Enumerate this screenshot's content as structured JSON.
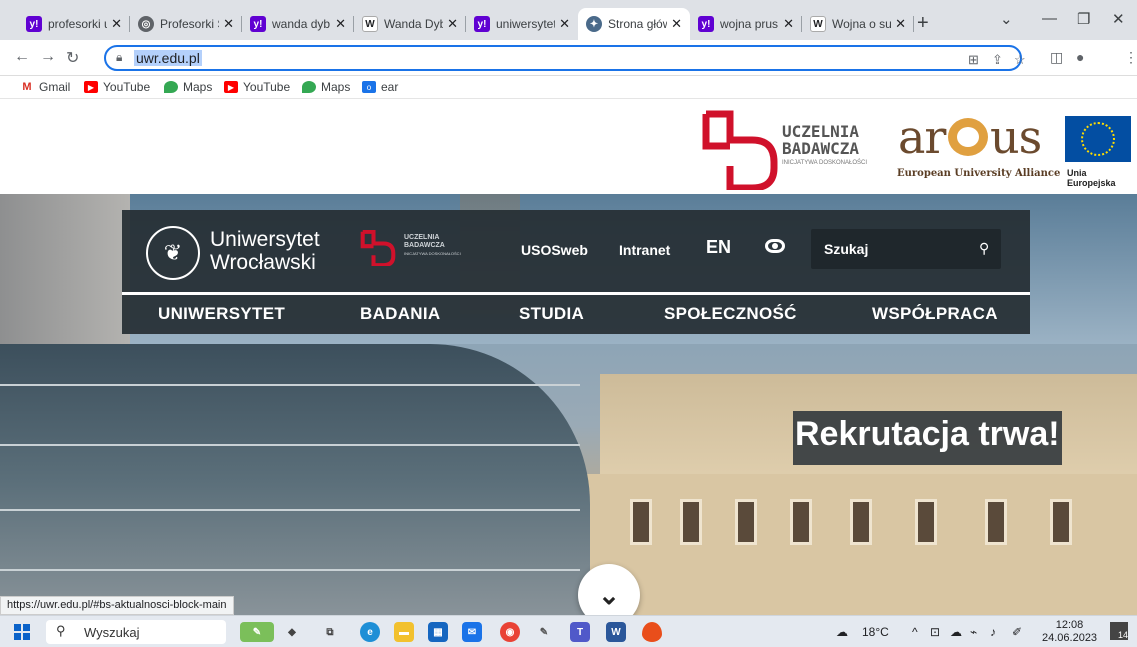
{
  "tabs": [
    {
      "title": "profesorki u",
      "favicon": "yahoo",
      "color": "#6001d2"
    },
    {
      "title": "Profesorki S",
      "favicon": "globe",
      "color": "#5f6368"
    },
    {
      "title": "wanda dyb",
      "favicon": "yahoo",
      "color": "#6001d2"
    },
    {
      "title": "Wanda Dyb",
      "favicon": "wikipedia",
      "color": "#202124"
    },
    {
      "title": "uniwersytet",
      "favicon": "yahoo",
      "color": "#6001d2"
    },
    {
      "title": "Strona głów",
      "favicon": "uwr-crest",
      "color": "#4a6a8a",
      "active": true
    },
    {
      "title": "wojna prus",
      "favicon": "yahoo",
      "color": "#6001d2"
    },
    {
      "title": "Wojna o su",
      "favicon": "wikipedia",
      "color": "#202124"
    }
  ],
  "address": {
    "url": "uwr.edu.pl"
  },
  "bookmarks": [
    {
      "label": "Gmail",
      "color": "#d93025",
      "icon": "M"
    },
    {
      "label": "YouTube",
      "color": "#ff0000",
      "icon": "▶"
    },
    {
      "label": "Maps",
      "color": "#34a853",
      "icon": "◉"
    },
    {
      "label": "YouTube",
      "color": "#ff0000",
      "icon": "▶"
    },
    {
      "label": "Maps",
      "color": "#34a853",
      "icon": "◉"
    },
    {
      "label": "ear",
      "color": "#1a73e8",
      "icon": "o"
    }
  ],
  "banner": {
    "ub_title_line1": "UCZELNIA",
    "ub_title_line2": "BADAWCZA",
    "ub_subtitle": "INICJATYWA DOSKONAŁOŚCI",
    "arqus_name": "arqus",
    "arqus_tagline": "European University Alliance",
    "eu_label": "Unia Europejska",
    "brand_red": "#d0112b",
    "arqus_brown": "#6b4a2e",
    "arqus_gold": "#e0a040",
    "eu_blue": "#034ea2"
  },
  "site": {
    "name_line1": "Uniwersytet",
    "name_line2": "Wrocławski",
    "ub_small_line1": "UCZELNIA",
    "ub_small_line2": "BADAWCZA",
    "ub_small_line3": "INICJATYWA DOSKONAŁOŚCI",
    "top_links": [
      "USOSweb",
      "Intranet"
    ],
    "lang": "EN",
    "search_placeholder": "Szukaj",
    "menu": [
      "UNIWERSYTET",
      "BADANIA",
      "STUDIA",
      "SPOŁECZNOŚĆ",
      "WSPÓŁPRACA"
    ],
    "hero_headline": "Rekrutacja trwa!"
  },
  "status_url": "https://uwr.edu.pl/#bs-aktualnosci-block-main",
  "taskbar": {
    "search_placeholder": "Wyszukaj",
    "weather": "18°C",
    "time": "12:08",
    "date": "24.06.2023",
    "notification_count": "14"
  }
}
